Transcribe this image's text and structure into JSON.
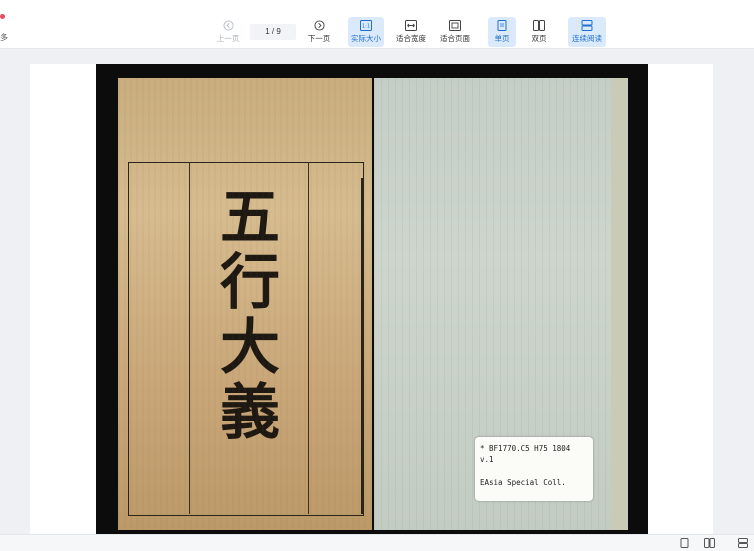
{
  "toolbar": {
    "brand_fragment": "多",
    "prev_label": "上一页",
    "page_indicator": "1 / 9",
    "next_label": "下一页",
    "actual_size_label": "实际大小",
    "fit_width_label": "适合宽度",
    "fit_page_label": "适合页面",
    "single_page_label": "单页",
    "double_page_label": "双页",
    "continuous_label": "连续阅读"
  },
  "document": {
    "title_chars": [
      "五",
      "行",
      "大",
      "義"
    ],
    "call_number": "* BF1770.C5 H75 1804",
    "volume": "v.1",
    "collection": "EAsia Special Coll."
  },
  "colors": {
    "accent": "#1f6fd1",
    "active_bg": "#dbeafb",
    "brand": "#e84a5f"
  }
}
